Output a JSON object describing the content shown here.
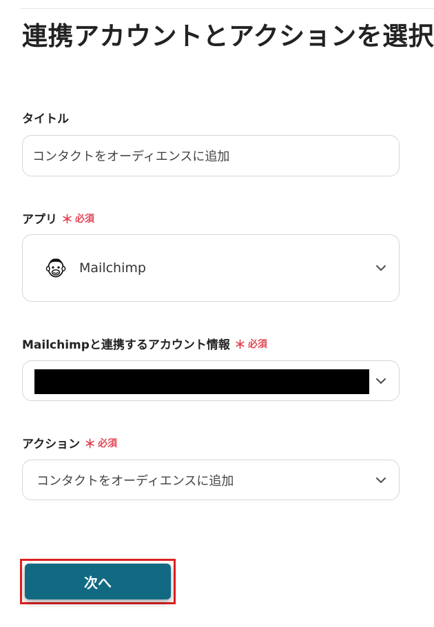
{
  "page_title": "連携アカウントとアクションを選択",
  "fields": {
    "title": {
      "label": "タイトル",
      "value": "コンタクトをオーディエンスに追加"
    },
    "app": {
      "label": "アプリ",
      "required_star": "＊",
      "required_text": "必須",
      "selected": "Mailchimp",
      "icon": "mailchimp-logo"
    },
    "account": {
      "label": "Mailchimpと連携するアカウント情報",
      "required_star": "＊",
      "required_text": "必須",
      "selected": ""
    },
    "action": {
      "label": "アクション",
      "required_star": "＊",
      "required_text": "必須",
      "selected": "コンタクトをオーディエンスに追加"
    }
  },
  "next_button": {
    "label": "次へ",
    "color": "#116a82"
  },
  "colors": {
    "required": "#e14856",
    "highlight": "#e02020",
    "border": "#d6d6d6"
  }
}
